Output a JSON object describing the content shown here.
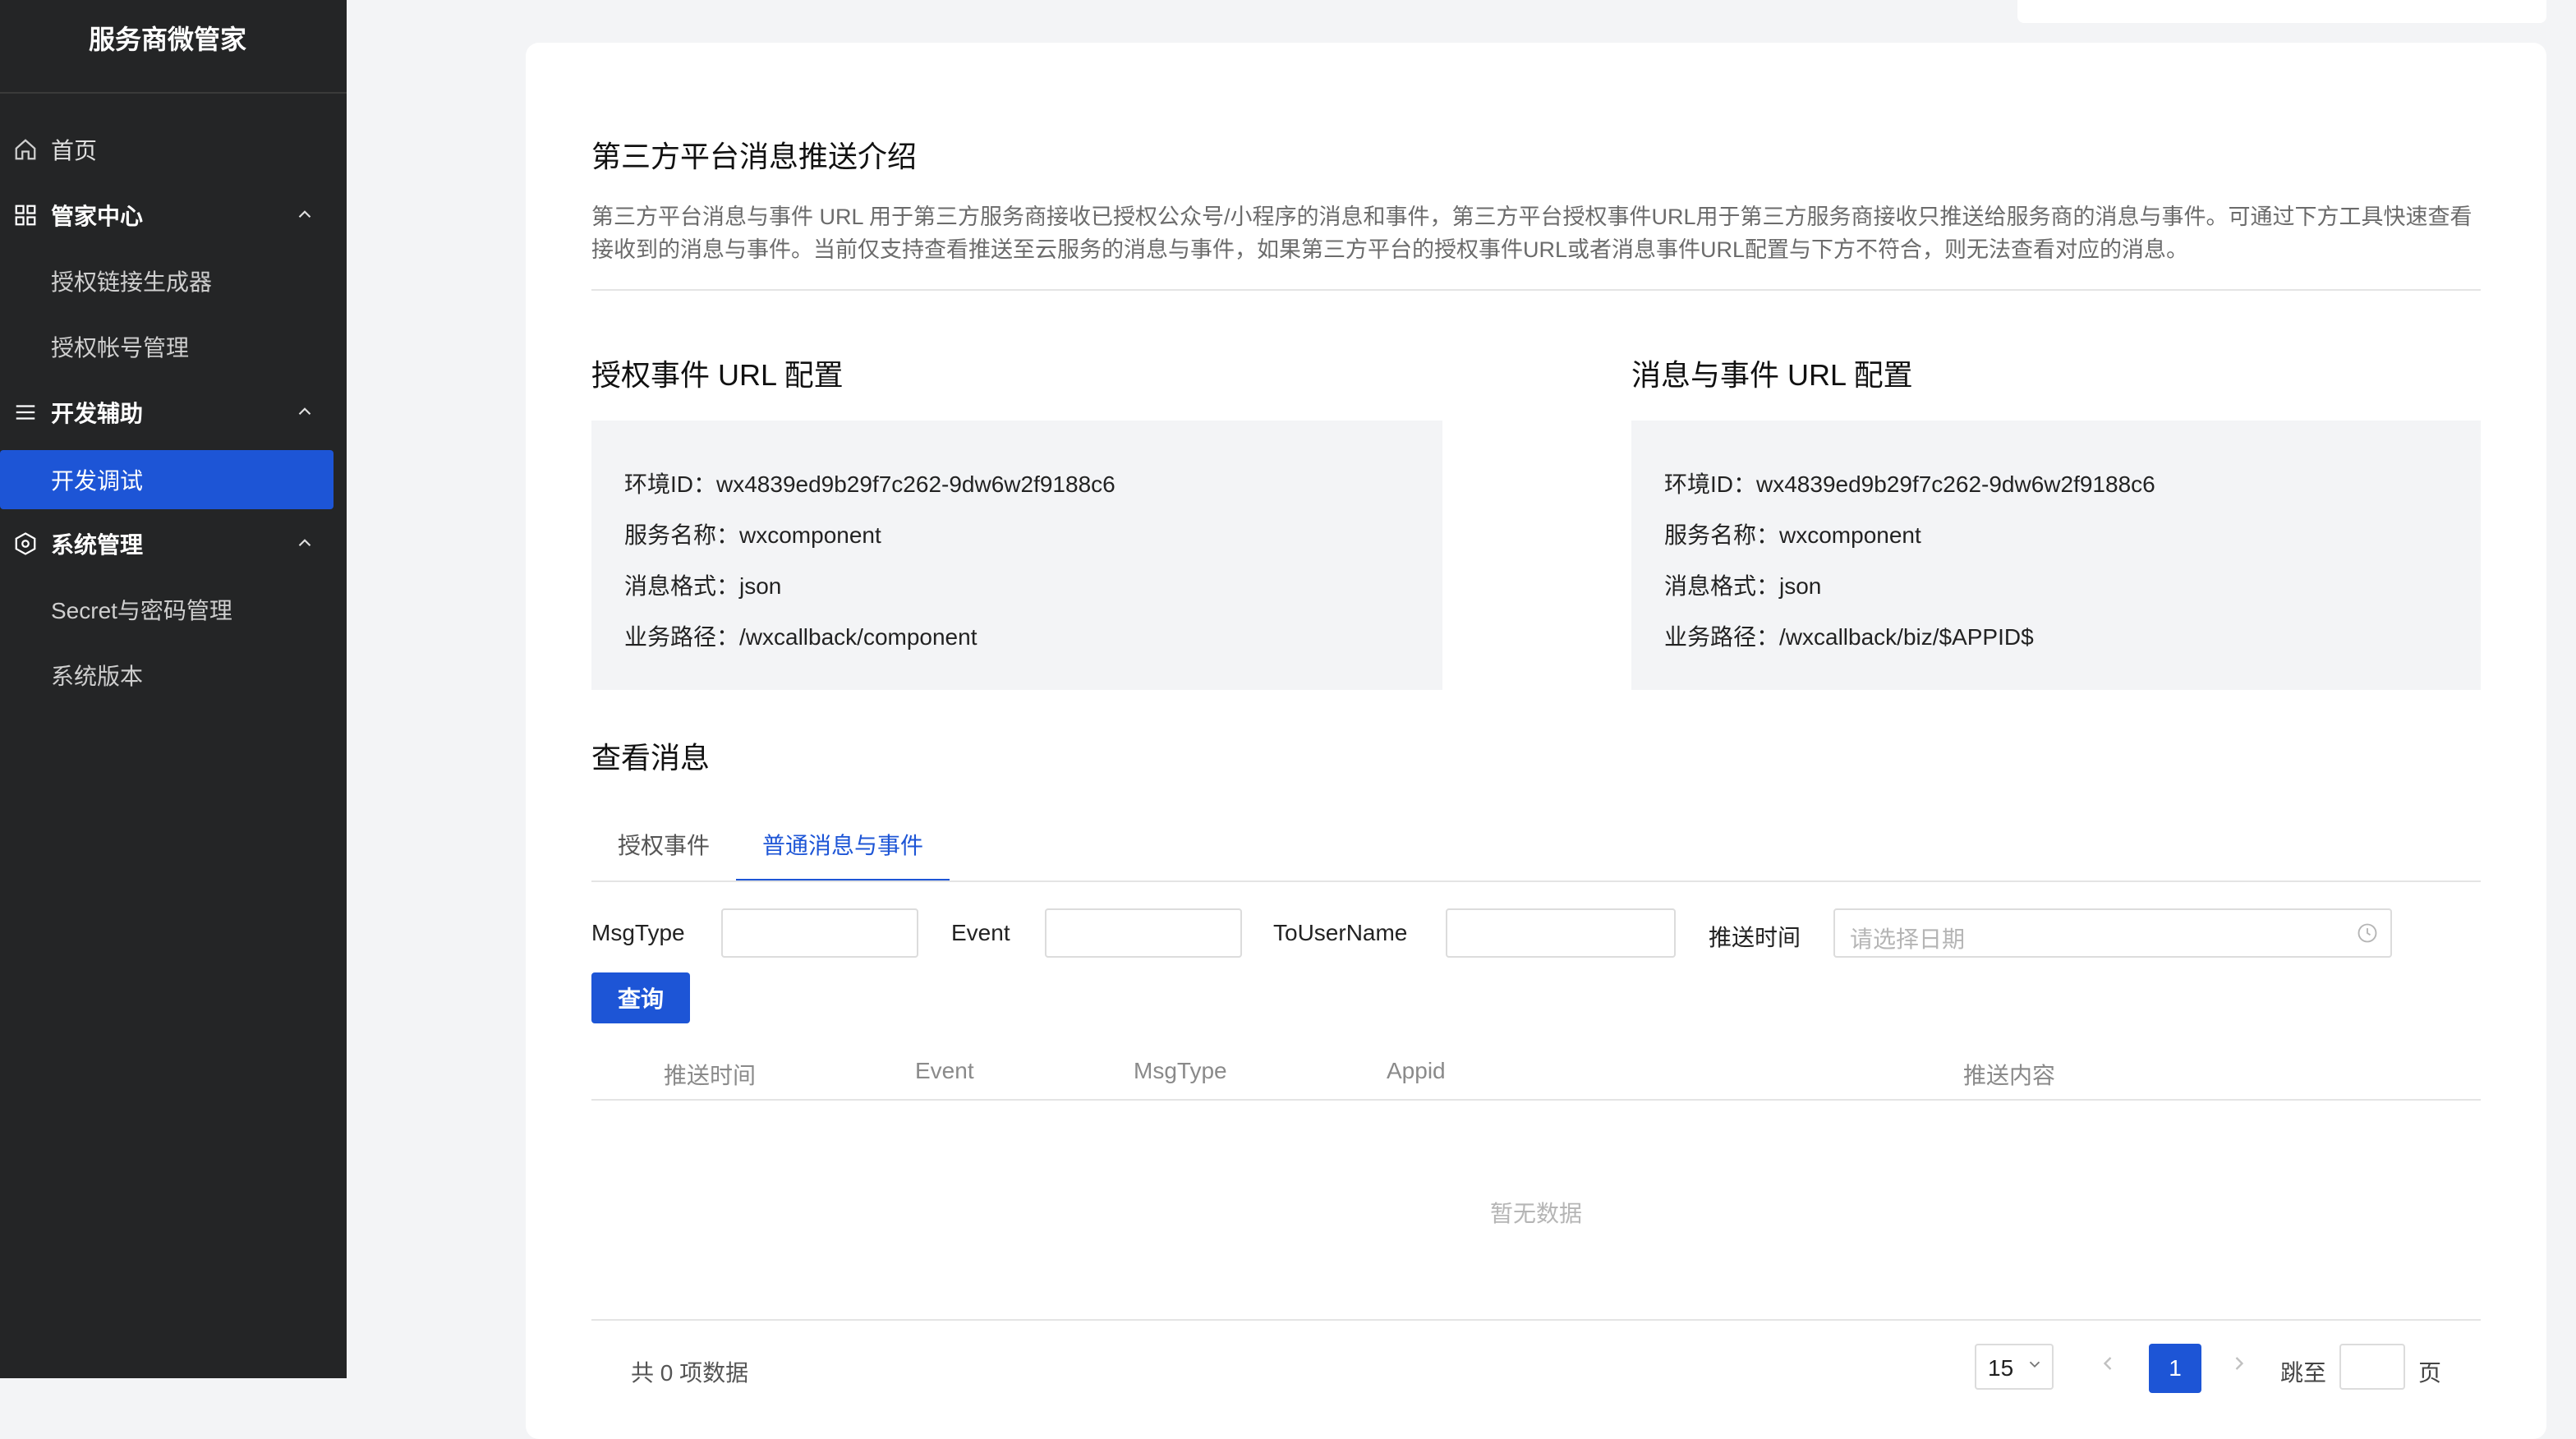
{
  "sidebar": {
    "brand": "服务商微管家",
    "items": [
      {
        "label": "首页"
      },
      {
        "label": "管家中心"
      },
      {
        "label": "授权链接生成器"
      },
      {
        "label": "授权帐号管理"
      },
      {
        "label": "开发辅助"
      },
      {
        "label": "开发调试"
      },
      {
        "label": "系统管理"
      },
      {
        "label": "Secret与密码管理"
      },
      {
        "label": "系统版本"
      }
    ]
  },
  "intro": {
    "title": "第三方平台消息推送介绍",
    "description": "第三方平台消息与事件 URL 用于第三方服务商接收已授权公众号/小程序的消息和事件，第三方平台授权事件URL用于第三方服务商接收只推送给服务商的消息与事件。可通过下方工具快速查看接收到的消息与事件。当前仅支持查看推送至云服务的消息与事件，如果第三方平台的授权事件URL或者消息事件URL配置与下方不符合，则无法查看对应的消息。"
  },
  "auth_config": {
    "title": "授权事件 URL 配置",
    "env": "环境ID：wx4839ed9b29f7c262-9dw6w2f9188c6",
    "service": "服务名称：wxcomponent",
    "format": "消息格式：json",
    "path": "业务路径：/wxcallback/component"
  },
  "msg_config": {
    "title": "消息与事件 URL 配置",
    "env": "环境ID：wx4839ed9b29f7c262-9dw6w2f9188c6",
    "service": "服务名称：wxcomponent",
    "format": "消息格式：json",
    "path": "业务路径：/wxcallback/biz/$APPID$"
  },
  "messages": {
    "title": "查看消息",
    "tabs": [
      "授权事件",
      "普通消息与事件"
    ],
    "filters": {
      "msgtype": "MsgType",
      "event": "Event",
      "tousername": "ToUserName",
      "push_time": "推送时间",
      "date_placeholder": "请选择日期"
    },
    "query_button": "查询",
    "columns": [
      "推送时间",
      "Event",
      "MsgType",
      "Appid",
      "推送内容"
    ],
    "empty": "暂无数据"
  },
  "pagination": {
    "total": "共 0 项数据",
    "page_size": "15",
    "current_page": "1",
    "jump_to": "跳至",
    "page_unit": "页"
  },
  "colors": {
    "accent": "#1d55d6",
    "sidebar": "#242526"
  }
}
